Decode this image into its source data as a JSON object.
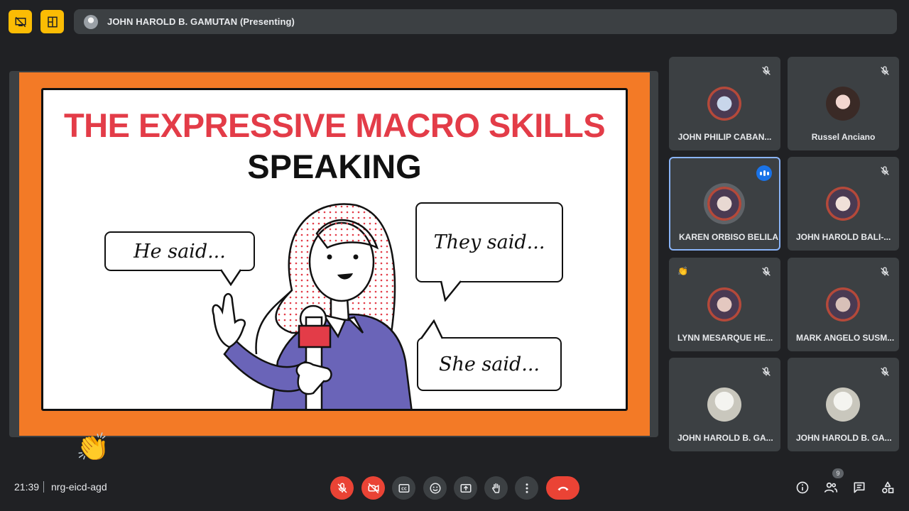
{
  "presenter_bar": {
    "title": "JOHN HAROLD B. GAMUTAN (Presenting)"
  },
  "slide": {
    "title": "THE EXPRESSIVE MACRO SKILLS",
    "subtitle": "SPEAKING",
    "bubble_left": "He said...",
    "bubble_right_top": "They said...",
    "bubble_right_bottom": "She said..."
  },
  "participants": [
    {
      "name": "JOHN PHILIP CABAN...",
      "muted": true
    },
    {
      "name": "Russel Anciano",
      "muted": true
    },
    {
      "name": "KAREN ORBISO BELILA",
      "speaking": true
    },
    {
      "name": "JOHN HAROLD BALI-...",
      "muted": true
    },
    {
      "name": "LYNN MESARQUE HE...",
      "muted": true,
      "reaction": "👏"
    },
    {
      "name": "MARK ANGELO SUSM...",
      "muted": true
    },
    {
      "name": "JOHN HAROLD B. GA...",
      "muted": true
    },
    {
      "name": "JOHN HAROLD B. GA...",
      "muted": true
    }
  ],
  "floating_reaction": "👏",
  "bottom_bar": {
    "time": "21:39",
    "meeting_code": "nrg-eicd-agd",
    "participant_count": "9"
  },
  "colors": {
    "accent_yellow": "#fbbc04",
    "danger_red": "#ea4335",
    "active_blue": "#8ab4f8",
    "slide_orange": "#f37a26",
    "slide_title_red": "#e33c48"
  }
}
